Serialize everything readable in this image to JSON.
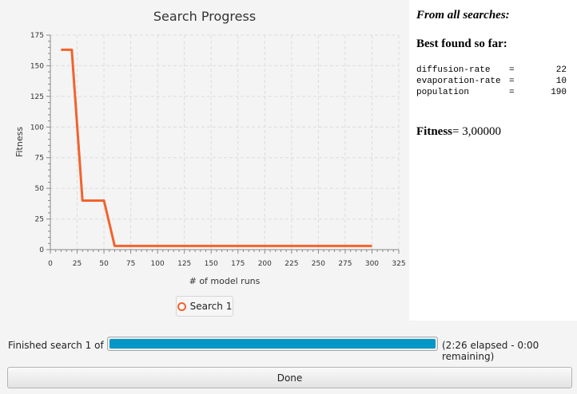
{
  "chart_data": {
    "type": "line",
    "title": "Search Progress",
    "xlabel": "# of model runs",
    "ylabel": "Fitness",
    "xlim": [
      0,
      325
    ],
    "ylim": [
      0,
      175
    ],
    "xticks": [
      0,
      25,
      50,
      75,
      100,
      125,
      150,
      175,
      200,
      225,
      250,
      275,
      300,
      325
    ],
    "yticks": [
      0,
      25,
      50,
      75,
      100,
      125,
      150,
      175
    ],
    "grid": true,
    "legend_position": "bottom",
    "series": [
      {
        "name": "Search 1",
        "color": "#f3622d",
        "x": [
          10,
          20,
          30,
          50,
          60,
          300
        ],
        "y": [
          163,
          163,
          40,
          40,
          3,
          3
        ]
      }
    ]
  },
  "info": {
    "heading": "From all searches:",
    "best_heading": "Best found so far:",
    "params": [
      {
        "name": "diffusion-rate",
        "eq": "=",
        "value": "22"
      },
      {
        "name": "evaporation-rate",
        "eq": "=",
        "value": "10"
      },
      {
        "name": "population",
        "eq": "=",
        "value": "190"
      }
    ],
    "fitness_label": "Fitness",
    "fitness_value": "= 3,00000"
  },
  "status": {
    "label": "Finished search 1 of 1:",
    "progress": 1.0,
    "time": "(2:26 elapsed - 0:00 remaining)"
  },
  "done_button": {
    "label": "Done"
  }
}
